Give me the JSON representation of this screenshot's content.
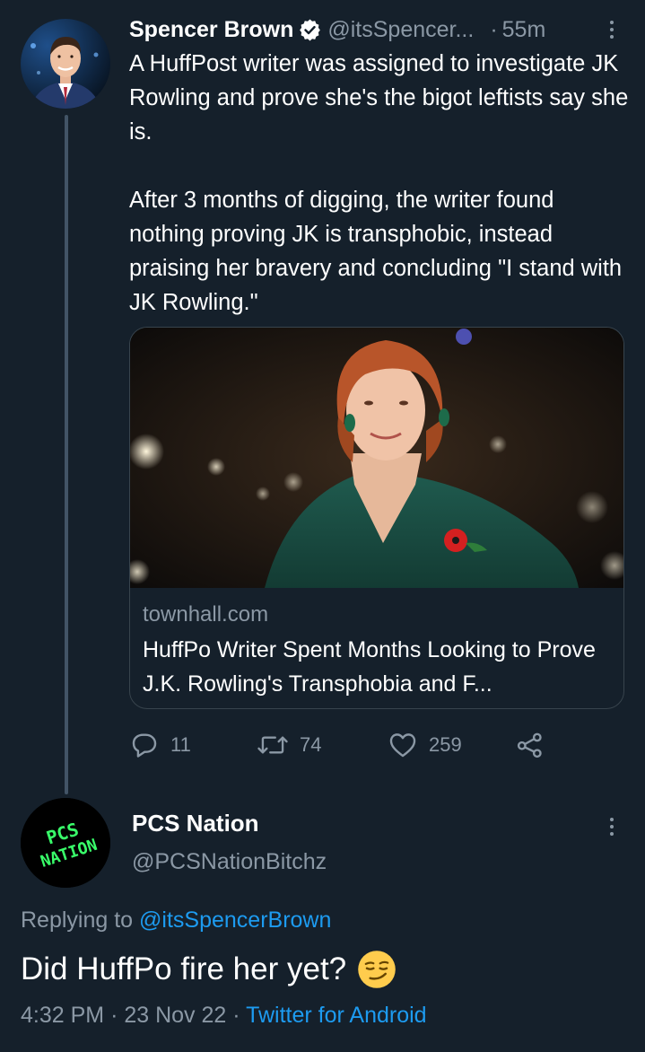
{
  "parent_tweet": {
    "display_name": "Spencer Brown",
    "handle": "@itsSpencer...",
    "separator": "·",
    "time": "55m",
    "text": "A HuffPost writer was assigned to investigate JK Rowling and prove she's the bigot leftists say she is.\n\nAfter 3 months of digging, the writer found nothing proving JK is transphobic, instead praising her bravery and concluding \"I stand with JK Rowling.\"",
    "card": {
      "domain": "townhall.com",
      "title": "HuffPo Writer Spent Months Looking to Prove J.K. Rowling's Transphobia and F..."
    },
    "actions": {
      "replies": "11",
      "retweets": "74",
      "likes": "259"
    }
  },
  "reply": {
    "avatar_text": "PCS NATION",
    "display_name": "PCS Nation",
    "handle": "@PCSNationBitchz",
    "replying_label": "Replying to",
    "replying_handle": "@itsSpencerBrown",
    "text": "Did HuffPo fire her yet?",
    "time": "4:32 PM",
    "date": "23 Nov 22",
    "client": "Twitter for Android",
    "meta_sep": "·"
  },
  "colors": {
    "background": "#15202b",
    "text_primary": "#ffffff",
    "text_secondary": "#8b98a5",
    "accent": "#1d9bf0",
    "thread_line": "#425466",
    "card_border": "#38444d",
    "avatar2_text": "#39ff6a"
  },
  "icons": {
    "verified": "verified-badge-icon",
    "more": "more-vertical-icon",
    "reply": "reply-icon",
    "retweet": "retweet-icon",
    "like": "heart-icon",
    "share": "share-icon",
    "emoji": "smirking-face-emoji"
  }
}
